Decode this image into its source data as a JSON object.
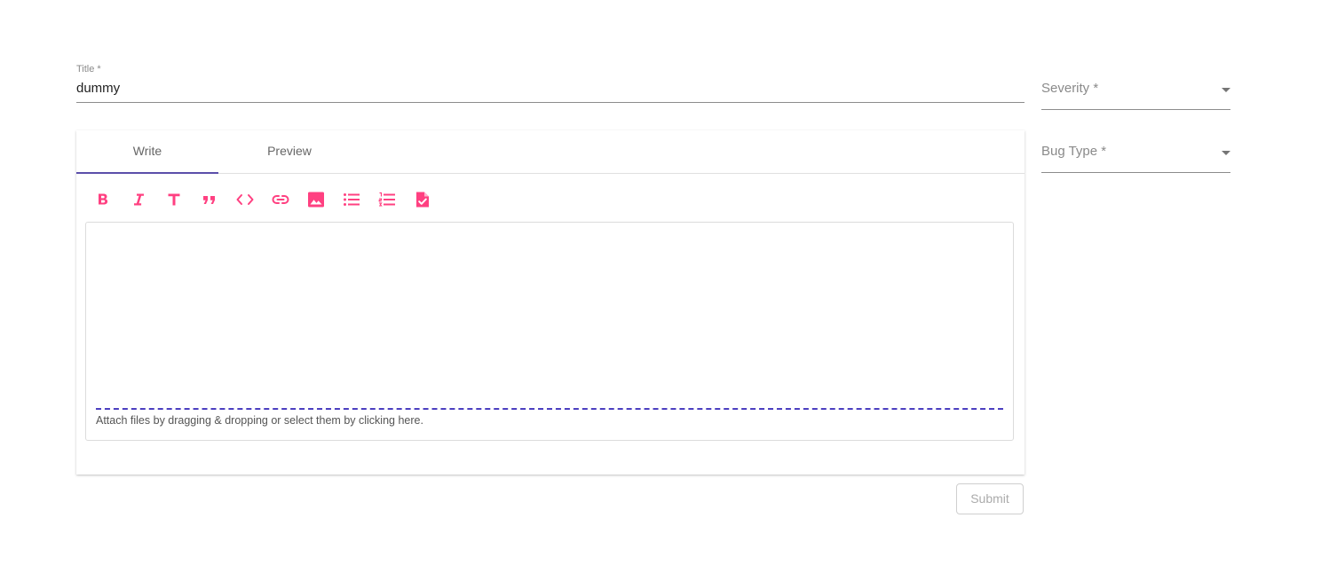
{
  "form": {
    "title_label": "Title *",
    "title_value": "dummy",
    "severity_label": "Severity *",
    "bug_type_label": "Bug Type *",
    "submit_label": "Submit"
  },
  "editor": {
    "tabs": [
      {
        "label": "Write",
        "active": true
      },
      {
        "label": "Preview",
        "active": false
      }
    ],
    "toolbar_icons": [
      "bold-icon",
      "italic-icon",
      "heading-icon",
      "quote-icon",
      "code-icon",
      "link-icon",
      "image-icon",
      "unordered-list-icon",
      "ordered-list-icon",
      "checked-list-icon"
    ],
    "content": "",
    "attach_hint": "Attach files by dragging & dropping or select them by clicking here."
  },
  "colors": {
    "accent": "#ff4081",
    "tab_indicator": "#5b4eaa",
    "drop_line": "#4c3fc0"
  }
}
